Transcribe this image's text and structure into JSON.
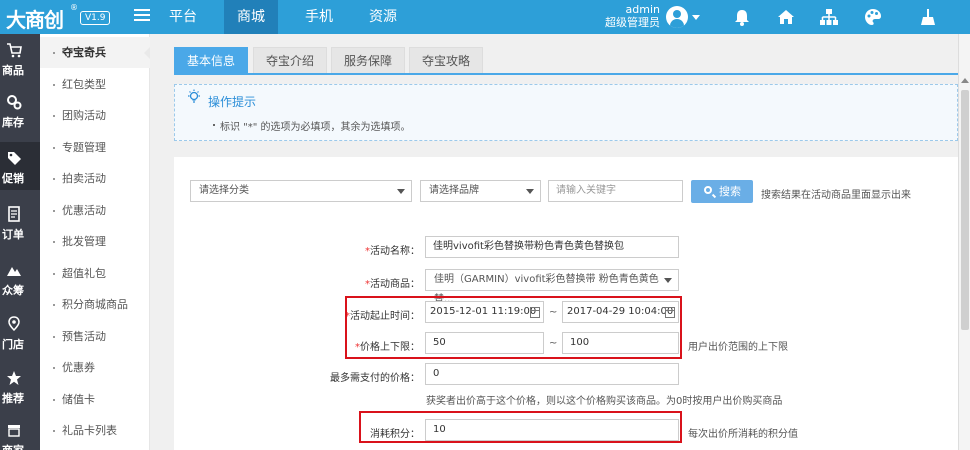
{
  "header": {
    "logo": "大商创",
    "logo_mark": "®",
    "version": "V1.9",
    "nav": [
      {
        "label": "平台",
        "active": false
      },
      {
        "label": "商城",
        "active": true
      },
      {
        "label": "手机",
        "active": false
      },
      {
        "label": "资源",
        "active": false
      }
    ],
    "user": {
      "name": "admin",
      "role": "超级管理员"
    },
    "icons": [
      "bell-icon",
      "home-icon",
      "sitemap-icon",
      "palette-icon",
      "broom-icon"
    ]
  },
  "iconbar": [
    {
      "label": "商品",
      "icon": "cart-icon"
    },
    {
      "label": "库存",
      "icon": "gears-icon"
    },
    {
      "label": "促销",
      "icon": "tag-icon",
      "active": true
    },
    {
      "label": "订单",
      "icon": "document-icon"
    },
    {
      "label": "众筹",
      "icon": "mountain-icon"
    },
    {
      "label": "门店",
      "icon": "map-pin-icon"
    },
    {
      "label": "推荐",
      "icon": "star-icon"
    },
    {
      "label": "商家",
      "icon": "store-icon"
    }
  ],
  "submenu": [
    {
      "label": "夺宝奇兵",
      "active": true
    },
    {
      "label": "红包类型"
    },
    {
      "label": "团购活动"
    },
    {
      "label": "专题管理"
    },
    {
      "label": "拍卖活动"
    },
    {
      "label": "优惠活动"
    },
    {
      "label": "批发管理"
    },
    {
      "label": "超值礼包"
    },
    {
      "label": "积分商城商品"
    },
    {
      "label": "预售活动"
    },
    {
      "label": "优惠券"
    },
    {
      "label": "储值卡"
    },
    {
      "label": "礼品卡列表"
    }
  ],
  "tabs": [
    {
      "label": "基本信息",
      "active": true
    },
    {
      "label": "夺宝介绍"
    },
    {
      "label": "服务保障"
    },
    {
      "label": "夺宝攻略"
    }
  ],
  "tips": {
    "title": "操作提示",
    "text": "标识 \"*\" 的选项为必填项，其余为选填项。"
  },
  "search": {
    "category_placeholder": "请选择分类",
    "brand_placeholder": "请选择品牌",
    "keyword_placeholder": "请输入关键字",
    "button": "搜索",
    "hint": "搜索结果在活动商品里面显示出来"
  },
  "form": {
    "activity_name": {
      "label": "活动名称：",
      "value": "佳明vivofit彩色替换带粉色青色黄色替换包"
    },
    "activity_goods": {
      "label": "活动商品：",
      "value": "佳明（GARMIN）vivofit彩色替换带 粉色青色黄色替..."
    },
    "time": {
      "label": "活动起止时间：",
      "start": "2015-12-01 11:19:00",
      "end": "2017-04-29 10:04:00"
    },
    "price": {
      "label": "价格上下限：",
      "min": "50",
      "max": "100",
      "hint": "用户出价范围的上下限"
    },
    "max_pay": {
      "label": "最多需支付的价格：",
      "value": "0",
      "hint": "获奖者出价高于这个价格，则以这个价格购买该商品。为0时按用户出价购买商品"
    },
    "points": {
      "label": "消耗积分：",
      "value": "10",
      "hint": "每次出价所消耗的积分值"
    },
    "required_mark": "*",
    "range_sep": "~"
  },
  "colors": {
    "header": "#2d9fd8",
    "header_active": "#2180b9",
    "highlight": "#d9121b",
    "accent": "#4aa8e8"
  }
}
